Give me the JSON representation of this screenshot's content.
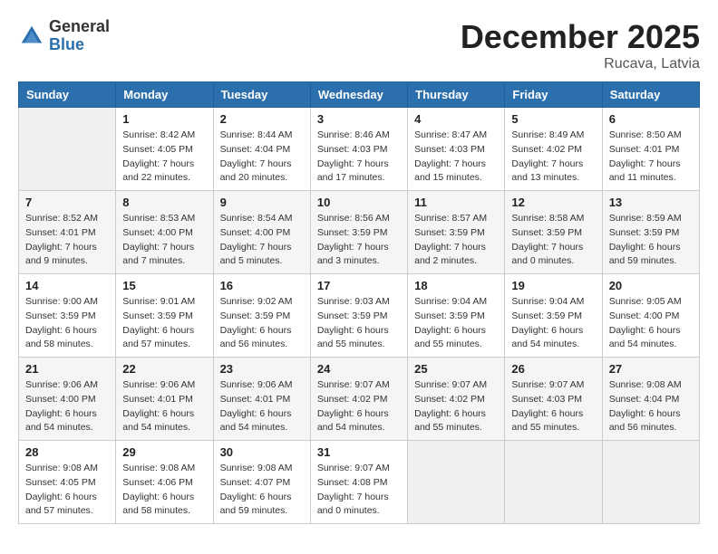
{
  "header": {
    "logo_general": "General",
    "logo_blue": "Blue",
    "month_title": "December 2025",
    "location": "Rucava, Latvia"
  },
  "weekdays": [
    "Sunday",
    "Monday",
    "Tuesday",
    "Wednesday",
    "Thursday",
    "Friday",
    "Saturday"
  ],
  "weeks": [
    [
      {
        "day": "",
        "sunrise": "",
        "sunset": "",
        "daylight": ""
      },
      {
        "day": "1",
        "sunrise": "Sunrise: 8:42 AM",
        "sunset": "Sunset: 4:05 PM",
        "daylight": "Daylight: 7 hours and 22 minutes."
      },
      {
        "day": "2",
        "sunrise": "Sunrise: 8:44 AM",
        "sunset": "Sunset: 4:04 PM",
        "daylight": "Daylight: 7 hours and 20 minutes."
      },
      {
        "day": "3",
        "sunrise": "Sunrise: 8:46 AM",
        "sunset": "Sunset: 4:03 PM",
        "daylight": "Daylight: 7 hours and 17 minutes."
      },
      {
        "day": "4",
        "sunrise": "Sunrise: 8:47 AM",
        "sunset": "Sunset: 4:03 PM",
        "daylight": "Daylight: 7 hours and 15 minutes."
      },
      {
        "day": "5",
        "sunrise": "Sunrise: 8:49 AM",
        "sunset": "Sunset: 4:02 PM",
        "daylight": "Daylight: 7 hours and 13 minutes."
      },
      {
        "day": "6",
        "sunrise": "Sunrise: 8:50 AM",
        "sunset": "Sunset: 4:01 PM",
        "daylight": "Daylight: 7 hours and 11 minutes."
      }
    ],
    [
      {
        "day": "7",
        "sunrise": "Sunrise: 8:52 AM",
        "sunset": "Sunset: 4:01 PM",
        "daylight": "Daylight: 7 hours and 9 minutes."
      },
      {
        "day": "8",
        "sunrise": "Sunrise: 8:53 AM",
        "sunset": "Sunset: 4:00 PM",
        "daylight": "Daylight: 7 hours and 7 minutes."
      },
      {
        "day": "9",
        "sunrise": "Sunrise: 8:54 AM",
        "sunset": "Sunset: 4:00 PM",
        "daylight": "Daylight: 7 hours and 5 minutes."
      },
      {
        "day": "10",
        "sunrise": "Sunrise: 8:56 AM",
        "sunset": "Sunset: 3:59 PM",
        "daylight": "Daylight: 7 hours and 3 minutes."
      },
      {
        "day": "11",
        "sunrise": "Sunrise: 8:57 AM",
        "sunset": "Sunset: 3:59 PM",
        "daylight": "Daylight: 7 hours and 2 minutes."
      },
      {
        "day": "12",
        "sunrise": "Sunrise: 8:58 AM",
        "sunset": "Sunset: 3:59 PM",
        "daylight": "Daylight: 7 hours and 0 minutes."
      },
      {
        "day": "13",
        "sunrise": "Sunrise: 8:59 AM",
        "sunset": "Sunset: 3:59 PM",
        "daylight": "Daylight: 6 hours and 59 minutes."
      }
    ],
    [
      {
        "day": "14",
        "sunrise": "Sunrise: 9:00 AM",
        "sunset": "Sunset: 3:59 PM",
        "daylight": "Daylight: 6 hours and 58 minutes."
      },
      {
        "day": "15",
        "sunrise": "Sunrise: 9:01 AM",
        "sunset": "Sunset: 3:59 PM",
        "daylight": "Daylight: 6 hours and 57 minutes."
      },
      {
        "day": "16",
        "sunrise": "Sunrise: 9:02 AM",
        "sunset": "Sunset: 3:59 PM",
        "daylight": "Daylight: 6 hours and 56 minutes."
      },
      {
        "day": "17",
        "sunrise": "Sunrise: 9:03 AM",
        "sunset": "Sunset: 3:59 PM",
        "daylight": "Daylight: 6 hours and 55 minutes."
      },
      {
        "day": "18",
        "sunrise": "Sunrise: 9:04 AM",
        "sunset": "Sunset: 3:59 PM",
        "daylight": "Daylight: 6 hours and 55 minutes."
      },
      {
        "day": "19",
        "sunrise": "Sunrise: 9:04 AM",
        "sunset": "Sunset: 3:59 PM",
        "daylight": "Daylight: 6 hours and 54 minutes."
      },
      {
        "day": "20",
        "sunrise": "Sunrise: 9:05 AM",
        "sunset": "Sunset: 4:00 PM",
        "daylight": "Daylight: 6 hours and 54 minutes."
      }
    ],
    [
      {
        "day": "21",
        "sunrise": "Sunrise: 9:06 AM",
        "sunset": "Sunset: 4:00 PM",
        "daylight": "Daylight: 6 hours and 54 minutes."
      },
      {
        "day": "22",
        "sunrise": "Sunrise: 9:06 AM",
        "sunset": "Sunset: 4:01 PM",
        "daylight": "Daylight: 6 hours and 54 minutes."
      },
      {
        "day": "23",
        "sunrise": "Sunrise: 9:06 AM",
        "sunset": "Sunset: 4:01 PM",
        "daylight": "Daylight: 6 hours and 54 minutes."
      },
      {
        "day": "24",
        "sunrise": "Sunrise: 9:07 AM",
        "sunset": "Sunset: 4:02 PM",
        "daylight": "Daylight: 6 hours and 54 minutes."
      },
      {
        "day": "25",
        "sunrise": "Sunrise: 9:07 AM",
        "sunset": "Sunset: 4:02 PM",
        "daylight": "Daylight: 6 hours and 55 minutes."
      },
      {
        "day": "26",
        "sunrise": "Sunrise: 9:07 AM",
        "sunset": "Sunset: 4:03 PM",
        "daylight": "Daylight: 6 hours and 55 minutes."
      },
      {
        "day": "27",
        "sunrise": "Sunrise: 9:08 AM",
        "sunset": "Sunset: 4:04 PM",
        "daylight": "Daylight: 6 hours and 56 minutes."
      }
    ],
    [
      {
        "day": "28",
        "sunrise": "Sunrise: 9:08 AM",
        "sunset": "Sunset: 4:05 PM",
        "daylight": "Daylight: 6 hours and 57 minutes."
      },
      {
        "day": "29",
        "sunrise": "Sunrise: 9:08 AM",
        "sunset": "Sunset: 4:06 PM",
        "daylight": "Daylight: 6 hours and 58 minutes."
      },
      {
        "day": "30",
        "sunrise": "Sunrise: 9:08 AM",
        "sunset": "Sunset: 4:07 PM",
        "daylight": "Daylight: 6 hours and 59 minutes."
      },
      {
        "day": "31",
        "sunrise": "Sunrise: 9:07 AM",
        "sunset": "Sunset: 4:08 PM",
        "daylight": "Daylight: 7 hours and 0 minutes."
      },
      {
        "day": "",
        "sunrise": "",
        "sunset": "",
        "daylight": ""
      },
      {
        "day": "",
        "sunrise": "",
        "sunset": "",
        "daylight": ""
      },
      {
        "day": "",
        "sunrise": "",
        "sunset": "",
        "daylight": ""
      }
    ]
  ]
}
